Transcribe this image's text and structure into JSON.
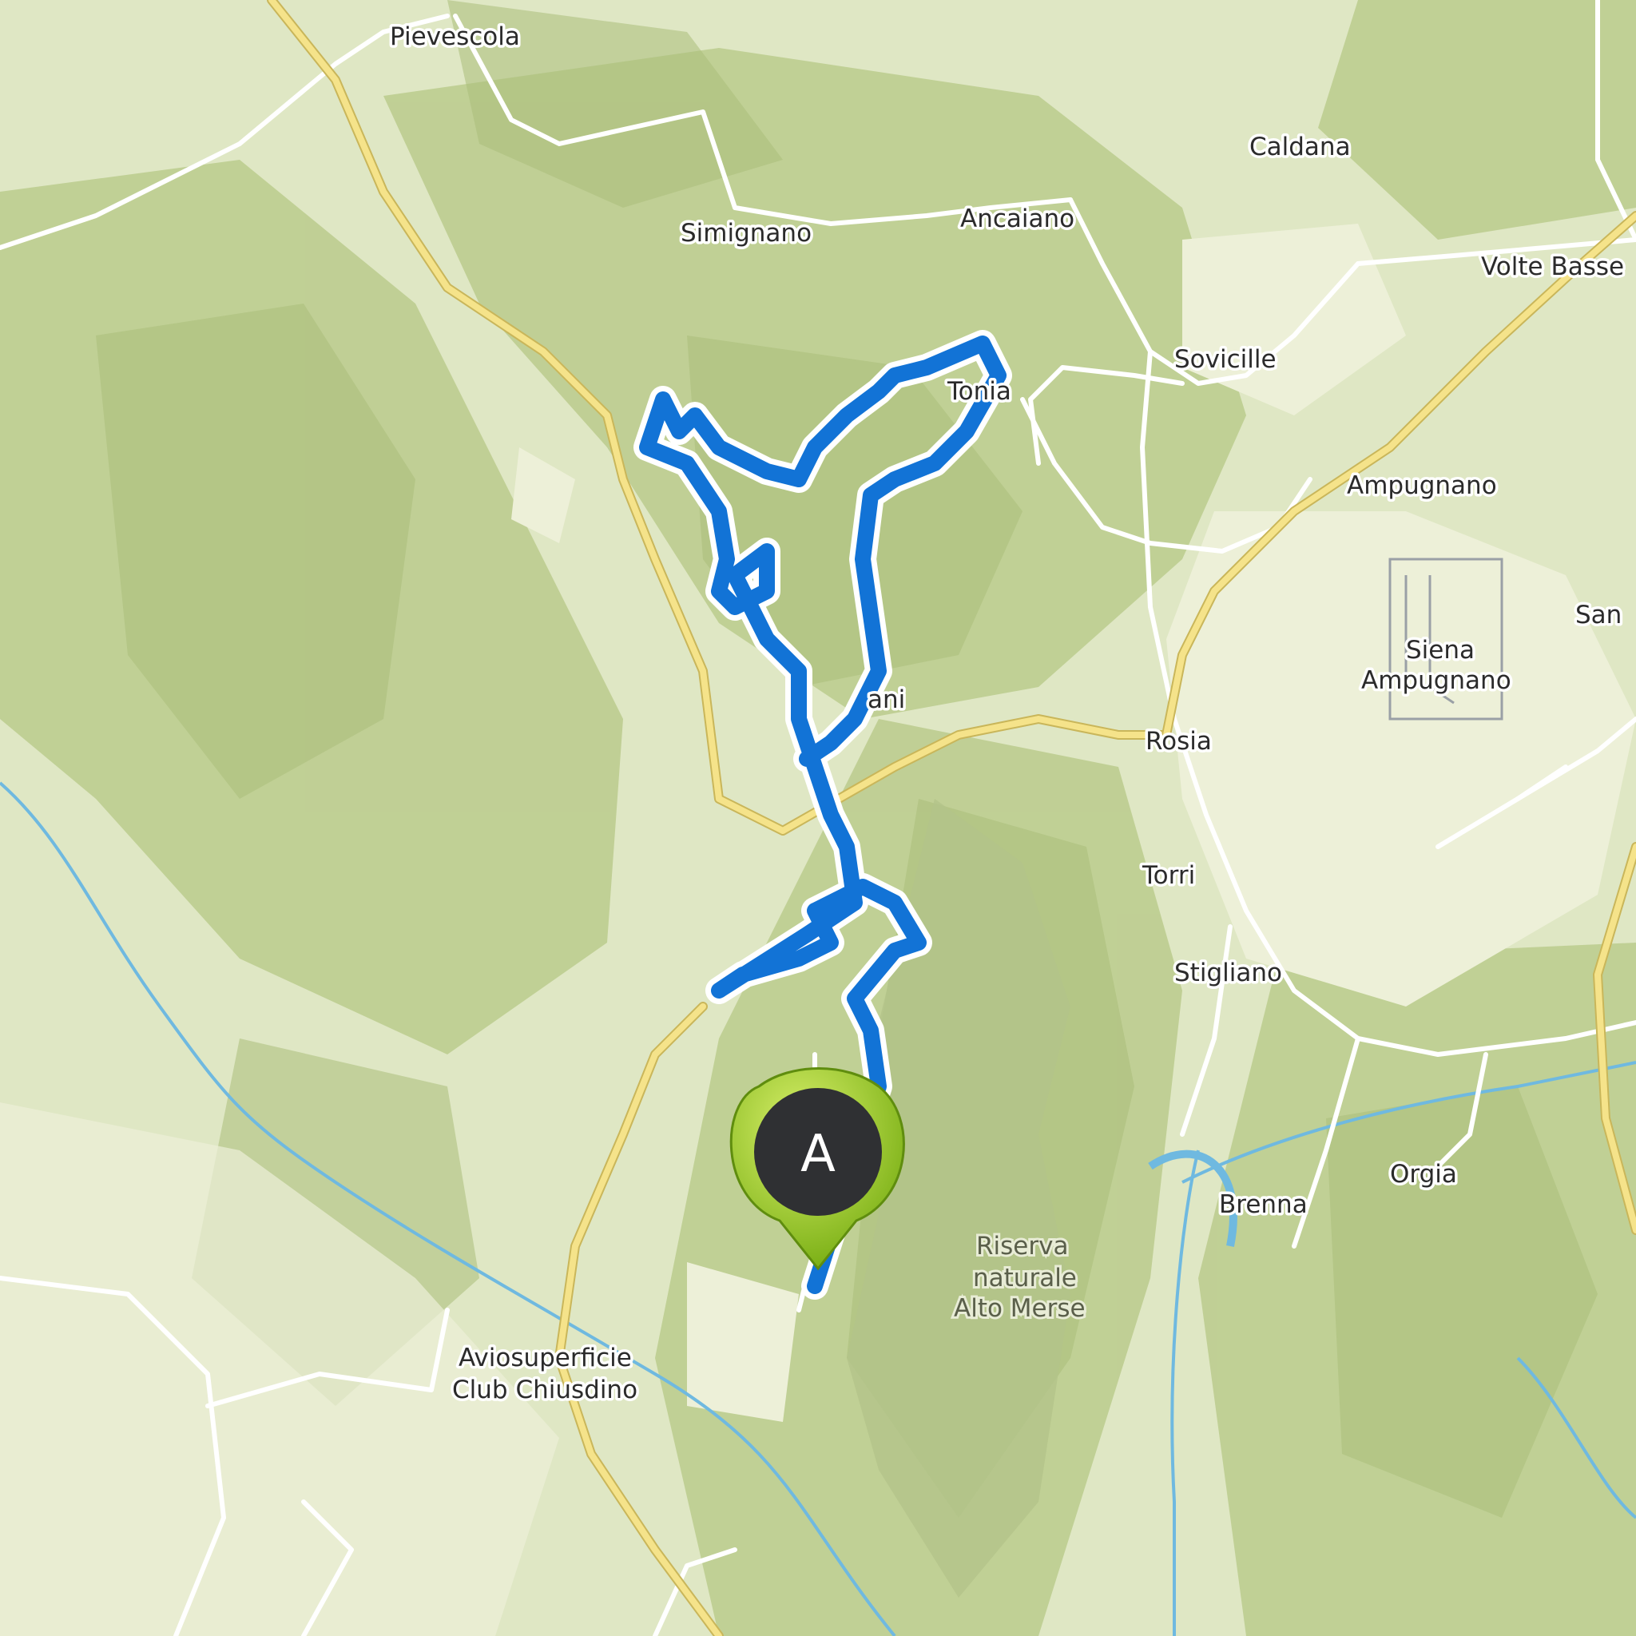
{
  "map": {
    "places": [
      {
        "id": "pievescola",
        "name": "Pievescola"
      },
      {
        "id": "caldana",
        "name": "Caldana"
      },
      {
        "id": "simignano",
        "name": "Simignano"
      },
      {
        "id": "ancaiano",
        "name": "Ancaiano"
      },
      {
        "id": "volte-basse",
        "name": "Volte Basse"
      },
      {
        "id": "sovicille",
        "name": "Sovicille"
      },
      {
        "id": "toiano",
        "name": "Tonia"
      },
      {
        "id": "ampugnano",
        "name": "Ampugnano"
      },
      {
        "id": "san",
        "name": "San"
      },
      {
        "id": "siena-ampugnano-1",
        "name": "Siena"
      },
      {
        "id": "siena-ampugnano-2",
        "name": "Ampugnano"
      },
      {
        "id": "rosia",
        "name": "Rosia"
      },
      {
        "id": "bagni",
        "name": "ani"
      },
      {
        "id": "torri",
        "name": "Torri"
      },
      {
        "id": "stigliano",
        "name": "Stigliano"
      },
      {
        "id": "orgia",
        "name": "Orgia"
      },
      {
        "id": "brenna",
        "name": "Brenna"
      },
      {
        "id": "riserva-1",
        "name": "Riserva"
      },
      {
        "id": "riserva-2",
        "name": "naturale"
      },
      {
        "id": "riserva-3",
        "name": "Alto Merse"
      },
      {
        "id": "avio-1",
        "name": "Aviosuperficie"
      },
      {
        "id": "avio-2",
        "name": "Club Chiusdino"
      }
    ],
    "marker": {
      "label": "A",
      "color": "#8fc31f"
    },
    "colors": {
      "route": "#1273d6",
      "terrain": "#dfe7c4",
      "forest": "#bccd8e",
      "road_major": "#f5e38a",
      "water": "#68b8e0"
    }
  }
}
